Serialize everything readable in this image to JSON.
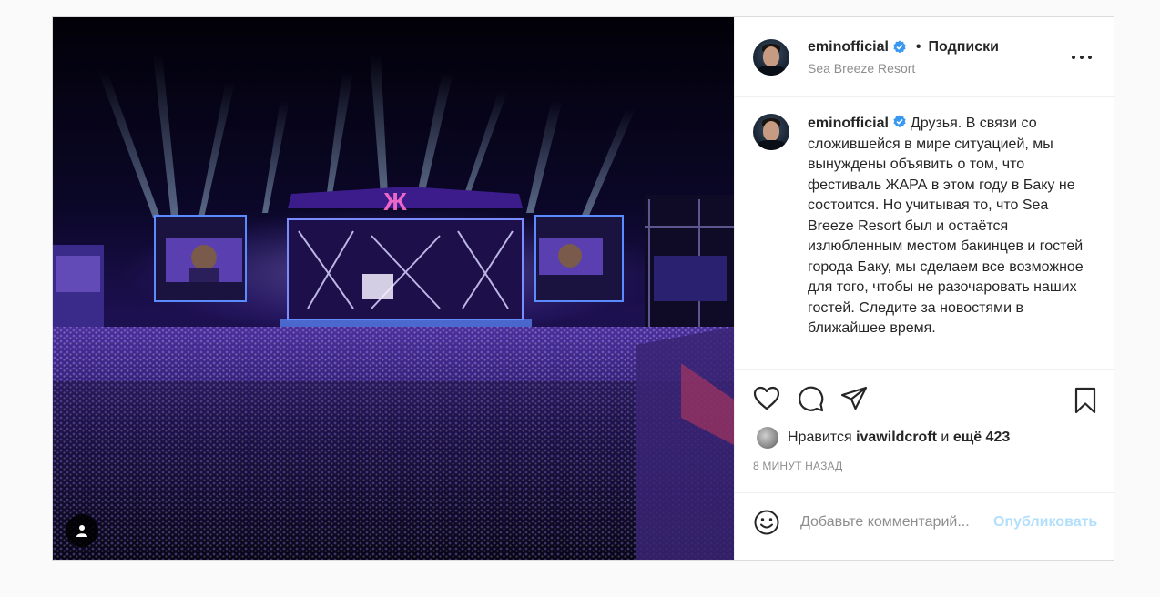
{
  "post": {
    "username": "eminofficial",
    "follow_status": "Подписки",
    "location": "Sea Breeze Resort",
    "separator": "•",
    "caption_user": "eminofficial",
    "caption_text": "Друзья. В связи со сложившейся в мире ситуацией, мы вынуждены объявить о том, что фестиваль ЖАРА в этом году в Баку не состоится. Но учитывая то, что Sea Breeze Resort был и остаётся излюбленным местом бакинцев и гостей города Баку, мы сделаем все возможное для того, чтобы не разочаровать наших гостей. Следите за новостями в ближайшее время.",
    "likes_prefix": "Нравится",
    "likes_user": "ivawildcroft",
    "likes_and": "и",
    "likes_more": "ещё 423",
    "timestamp": "8 МИНУТ НАЗАД"
  },
  "comment": {
    "placeholder": "Добавьте комментарий...",
    "publish_label": "Опубликовать"
  },
  "icons": {
    "verified": "verified-badge-icon",
    "more": "more-options-icon",
    "like": "heart-icon",
    "comment": "comment-bubble-icon",
    "share": "paper-plane-icon",
    "save": "bookmark-icon",
    "emoji": "smiley-icon",
    "tag": "person-tag-icon"
  },
  "colors": {
    "verified_blue": "#3897f0",
    "publish_disabled": "#b2dffc",
    "meta_gray": "#8e8e8e",
    "text": "#262626"
  }
}
